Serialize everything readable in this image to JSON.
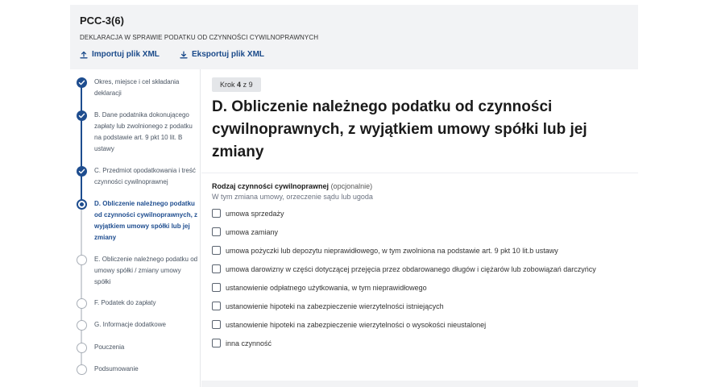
{
  "header": {
    "form_code": "PCC-3(6)",
    "form_description": "DEKLARACJA W SPRAWIE PODATKU OD CZYNNOŚCI CYWILNOPRAWNYCH",
    "import_label": "Importuj plik XML",
    "export_label": "Eksportuj plik XML",
    "import_icon": "upload-icon",
    "export_icon": "download-icon"
  },
  "colors": {
    "accent": "#1e4d8f",
    "header_bg": "#f2f3f5",
    "inactive": "#a8aeb6"
  },
  "steps": [
    {
      "label": "Okres, miejsce i cel składania deklaracji",
      "status": "done"
    },
    {
      "label": "B. Dane podatnika dokonującego zapłaty lub zwolnionego z podatku na podstawie art. 9 pkt 10 lit. B ustawy",
      "status": "done"
    },
    {
      "label": "C. Przedmiot opodatkowania i treść czynności cywilnoprawnej",
      "status": "done"
    },
    {
      "label": "D. Obliczenie należnego podatku od czynności cywilnoprawnych, z wyjątkiem umowy spółki lub jej zmiany",
      "status": "current"
    },
    {
      "label": "E. Obliczenie należnego podatku od umowy spółki / zmiany umowy spółki",
      "status": "todo"
    },
    {
      "label": "F. Podatek do zapłaty",
      "status": "todo"
    },
    {
      "label": "G. Informacje dodatkowe",
      "status": "todo"
    },
    {
      "label": "Pouczenia",
      "status": "todo"
    },
    {
      "label": "Podsumowanie",
      "status": "todo"
    }
  ],
  "content": {
    "step_prefix": "Krok",
    "step_current": "4",
    "step_separator": "z",
    "step_total": "9",
    "section_title": "D. Obliczenie należnego podatku od czynności cywilnoprawnych, z wyjątkiem umowy spółki lub jej zmiany",
    "field_label": "Rodzaj czynności cywilnoprawnej",
    "field_optional": "(opcjonalnie)",
    "field_hint": "W tym zmiana umowy, orzeczenie sądu lub ugoda",
    "options": [
      {
        "label": "umowa sprzedaży",
        "checked": false
      },
      {
        "label": "umowa zamiany",
        "checked": false
      },
      {
        "label": "umowa pożyczki lub depozytu nieprawidłowego, w tym zwolniona na podstawie art. 9 pkt 10 lit.b ustawy",
        "checked": false
      },
      {
        "label": "umowa darowizny w części dotyczącej przejęcia przez obdarowanego długów i ciężarów lub zobowiązań darczyńcy",
        "checked": false
      },
      {
        "label": "ustanowienie odpłatnego użytkowania, w tym nieprawidłowego",
        "checked": false
      },
      {
        "label": "ustanowienie hipoteki na zabezpieczenie wierzytelności istniejących",
        "checked": false
      },
      {
        "label": "ustanowienie hipoteki na zabezpieczenie wierzytelności o wysokości nieustalonej",
        "checked": false
      },
      {
        "label": "inna czynność",
        "checked": false
      }
    ]
  }
}
